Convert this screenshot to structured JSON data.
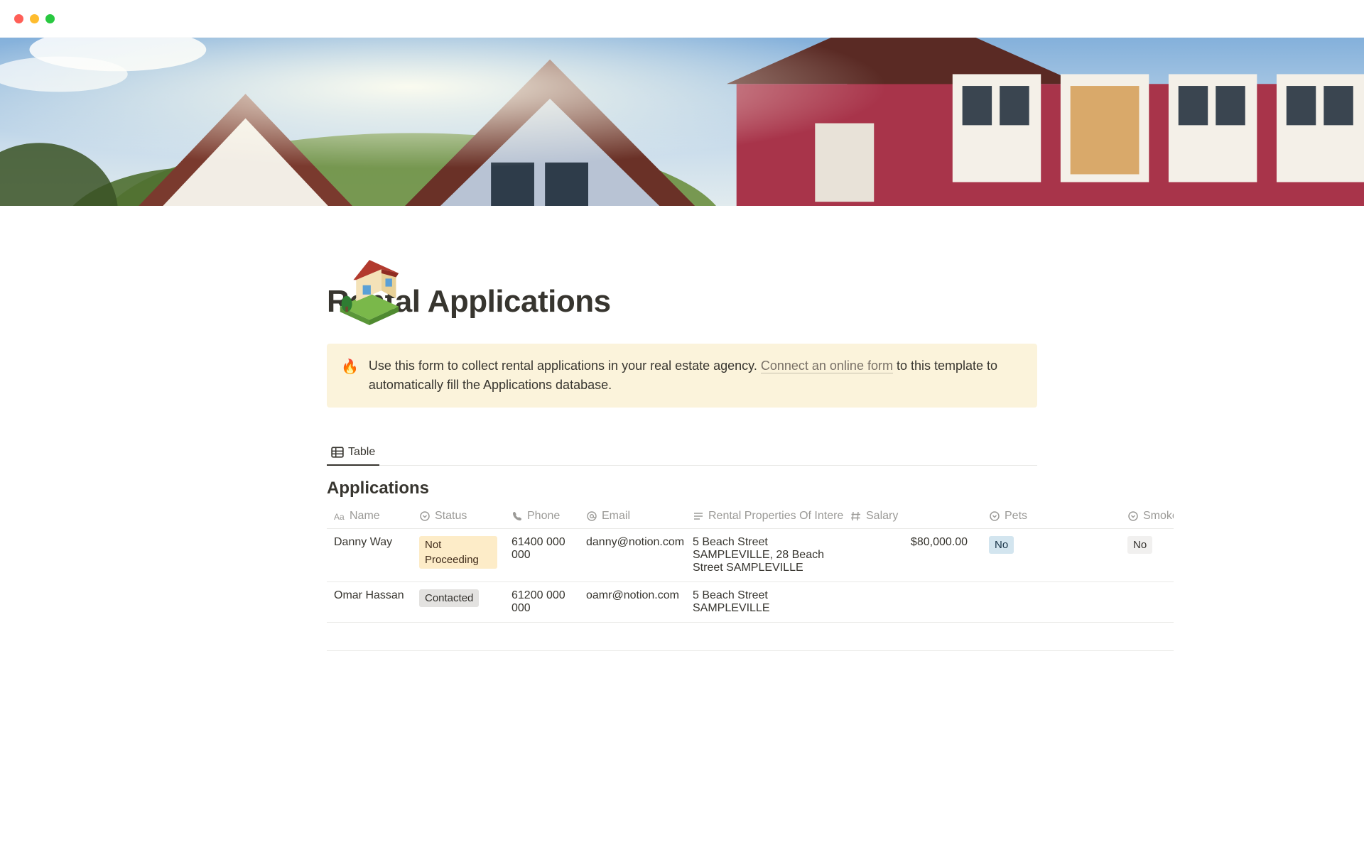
{
  "page": {
    "title": "Rental Applications",
    "icon_emoji": "🏠"
  },
  "callout": {
    "emoji": "🔥",
    "text_before": "Use this form to collect rental applications in your real estate agency. ",
    "link_text": "Connect an online form",
    "text_after": " to this template to automatically fill the Applications database."
  },
  "view": {
    "active_tab": "Table"
  },
  "database": {
    "title": "Applications",
    "columns": [
      {
        "key": "name",
        "label": "Name",
        "icon": "title"
      },
      {
        "key": "status",
        "label": "Status",
        "icon": "select"
      },
      {
        "key": "phone",
        "label": "Phone",
        "icon": "phone"
      },
      {
        "key": "email",
        "label": "Email",
        "icon": "at"
      },
      {
        "key": "properties",
        "label": "Rental Properties Of Interest",
        "icon": "text"
      },
      {
        "key": "salary",
        "label": "Salary",
        "icon": "number"
      },
      {
        "key": "pets",
        "label": "Pets",
        "icon": "select"
      },
      {
        "key": "smoker",
        "label": "Smoker",
        "icon": "select"
      }
    ],
    "rows": [
      {
        "name": "Danny Way",
        "status": {
          "label": "Not Proceeding",
          "color": "yellow"
        },
        "phone": "61400 000 000",
        "email": "danny@notion.com",
        "properties": "5 Beach Street SAMPLEVILLE, 28 Beach Street SAMPLEVILLE",
        "salary": "$80,000.00",
        "pets": {
          "label": "No",
          "color": "blue"
        },
        "smoker": {
          "label": "No",
          "color": "default"
        }
      },
      {
        "name": "Omar Hassan",
        "status": {
          "label": "Contacted",
          "color": "gray"
        },
        "phone": "61200 000 000",
        "email": "oamr@notion.com",
        "properties": "5 Beach Street SAMPLEVILLE",
        "salary": "",
        "pets": null,
        "smoker": null
      }
    ]
  }
}
